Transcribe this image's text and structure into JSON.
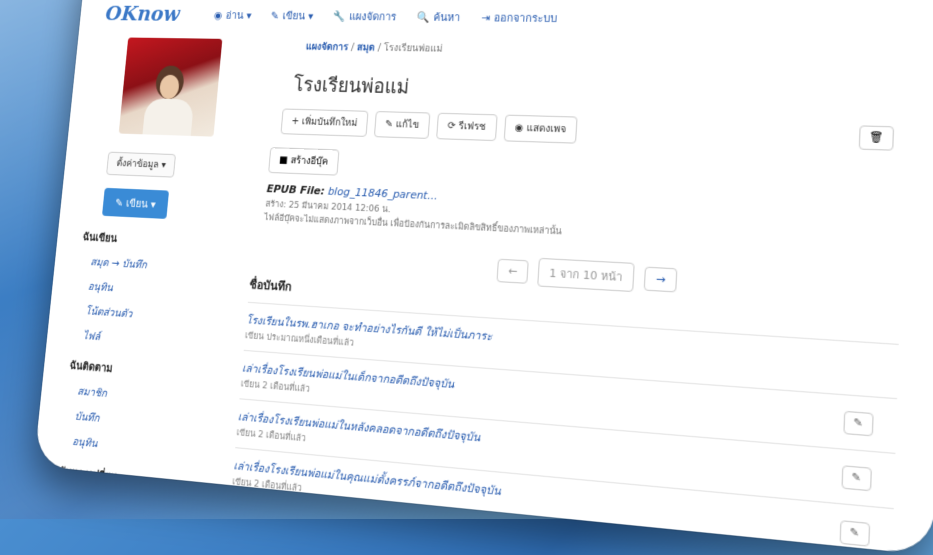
{
  "logo": "OKnow",
  "topnav": [
    {
      "icon": "eye-icon",
      "glyph": "◉",
      "label": "อ่าน ▾"
    },
    {
      "icon": "edit-icon",
      "glyph": "✎",
      "label": "เขียน ▾"
    },
    {
      "icon": "wrench-icon",
      "glyph": "🔧",
      "label": "แผงจัดการ"
    },
    {
      "icon": "search-icon",
      "glyph": "🔍",
      "label": "ค้นหา"
    },
    {
      "icon": "logout-icon",
      "glyph": "⇥",
      "label": "ออกจากระบบ"
    }
  ],
  "sidebar": {
    "settings_label": "ตั้งค่าข้อมูล ▾",
    "write_label": "✎ เขียน ▾",
    "sections": [
      {
        "heading": "ฉันเขียน",
        "items": [
          "สมุด → บันทึก",
          "อนุทิน",
          "โน้ตส่วนตัว",
          "ไฟล์"
        ]
      },
      {
        "heading": "ฉันติดตาม",
        "items": [
          "สมาชิก",
          "บันทึก",
          "อนุทิน"
        ]
      },
      {
        "heading": "ฉันแลกเปลี่ยน",
        "items": []
      }
    ]
  },
  "breadcrumb": [
    "แผงจัดการ",
    "สมุด",
    "โรงเรียนพ่อแม่"
  ],
  "page_title": "โรงเรียนพ่อแม่",
  "toolbar": [
    "+ เพิ่มบันทึกใหม่",
    "✎ แก้ไข",
    "⟳ รีเฟรช",
    "◉ แสดงเพจ"
  ],
  "epub": {
    "button": "■ สร้างอีบุ๊ค",
    "label": "EPUB File:",
    "file": "blog_11846_parent...",
    "created": "สร้าง: 25 มีนาคม 2014 12:06 น.",
    "note": "ไฟล์อีบุ๊คจะไม่แสดงภาพจากเว็บอื่น เพื่อป้องกันการละเมิดลิขสิทธิ์ของภาพเหล่านั้น"
  },
  "pager": {
    "prev": "←",
    "status": "1 จาก 10 หน้า",
    "next": "→"
  },
  "list_heading": "ชื่อบันทึก",
  "entries": [
    {
      "title": "โรงเรียนในรพ.ฮาเกอ จะทำอย่างไรกันดี ให้ไม่เป็นภาระ",
      "sub": "เขียน ประมาณหนึ่งเดือนที่แล้ว"
    },
    {
      "title": "เล่าเรื่องโรงเรียนพ่อแม่ในเด็กจากอดีตถึงปัจจุบัน",
      "sub": "เขียน 2 เดือนที่แล้ว"
    },
    {
      "title": "เล่าเรื่องโรงเรียนพ่อแม่ในหลังคลอดจากอดีตถึงปัจจุบัน",
      "sub": "เขียน 2 เดือนที่แล้ว"
    },
    {
      "title": "เล่าเรื่องโรงเรียนพ่อแม่ในคุณแม่ตั้งครรภ์จากอดีตถึงปัจจุบัน",
      "sub": "เขียน 2 เดือนที่แล้ว"
    }
  ]
}
